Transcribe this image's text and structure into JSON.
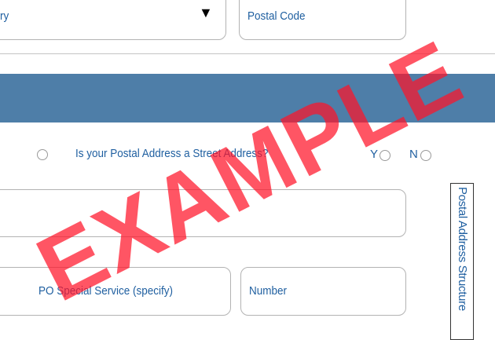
{
  "address_top": {
    "country_label": "ry",
    "country_dropdown_icon": "triangle-down",
    "postal_code_label": "Postal Code"
  },
  "postal": {
    "question": "Is your Postal Address a Street Address?",
    "yes_label": "Y",
    "no_label": "N",
    "po_special_service_label": "PO Special Service (specify)",
    "number_label": "Number",
    "side_label": "Postal Address Structure"
  },
  "watermark": "EXAMPLE",
  "colors": {
    "band": "#4e7ea8",
    "label_text": "#1f5fa0",
    "watermark": "#ff1428"
  }
}
